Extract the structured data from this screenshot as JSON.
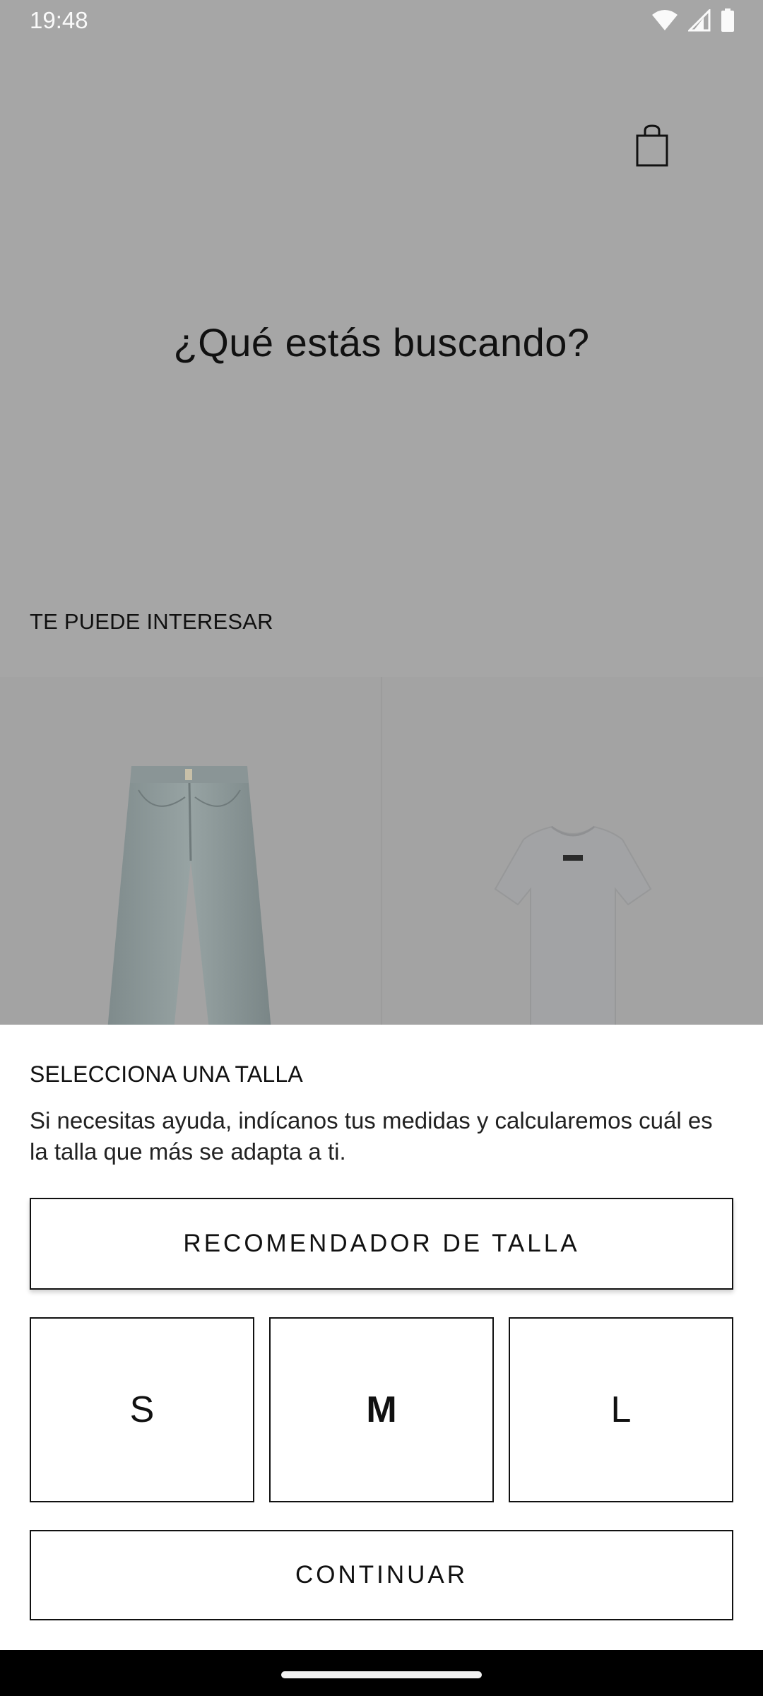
{
  "status_bar": {
    "time": "19:48",
    "icons": [
      "wifi-icon",
      "signal-icon",
      "battery-icon"
    ]
  },
  "header": {
    "cart_icon": "shopping-bag-icon"
  },
  "search": {
    "prompt": "¿Qué estás buscando?"
  },
  "recommendations": {
    "label": "TE PUEDE INTERESAR",
    "products": [
      {
        "image": "jeans"
      },
      {
        "image": "t-shirt"
      }
    ]
  },
  "size_sheet": {
    "title": "SELECCIONA UNA TALLA",
    "description": "Si necesitas ayuda, indícanos tus medidas y calcularemos cuál es la talla que más se adapta a ti.",
    "recommender_label": "RECOMENDADOR DE TALLA",
    "sizes": [
      {
        "label": "S",
        "selected": false
      },
      {
        "label": "M",
        "selected": true
      },
      {
        "label": "L",
        "selected": false
      }
    ],
    "continue_label": "CONTINUAR"
  },
  "colors": {
    "backdrop": "#a6a6a6",
    "sheet": "#ffffff",
    "text": "#111111",
    "nav_bar": "#000000"
  }
}
